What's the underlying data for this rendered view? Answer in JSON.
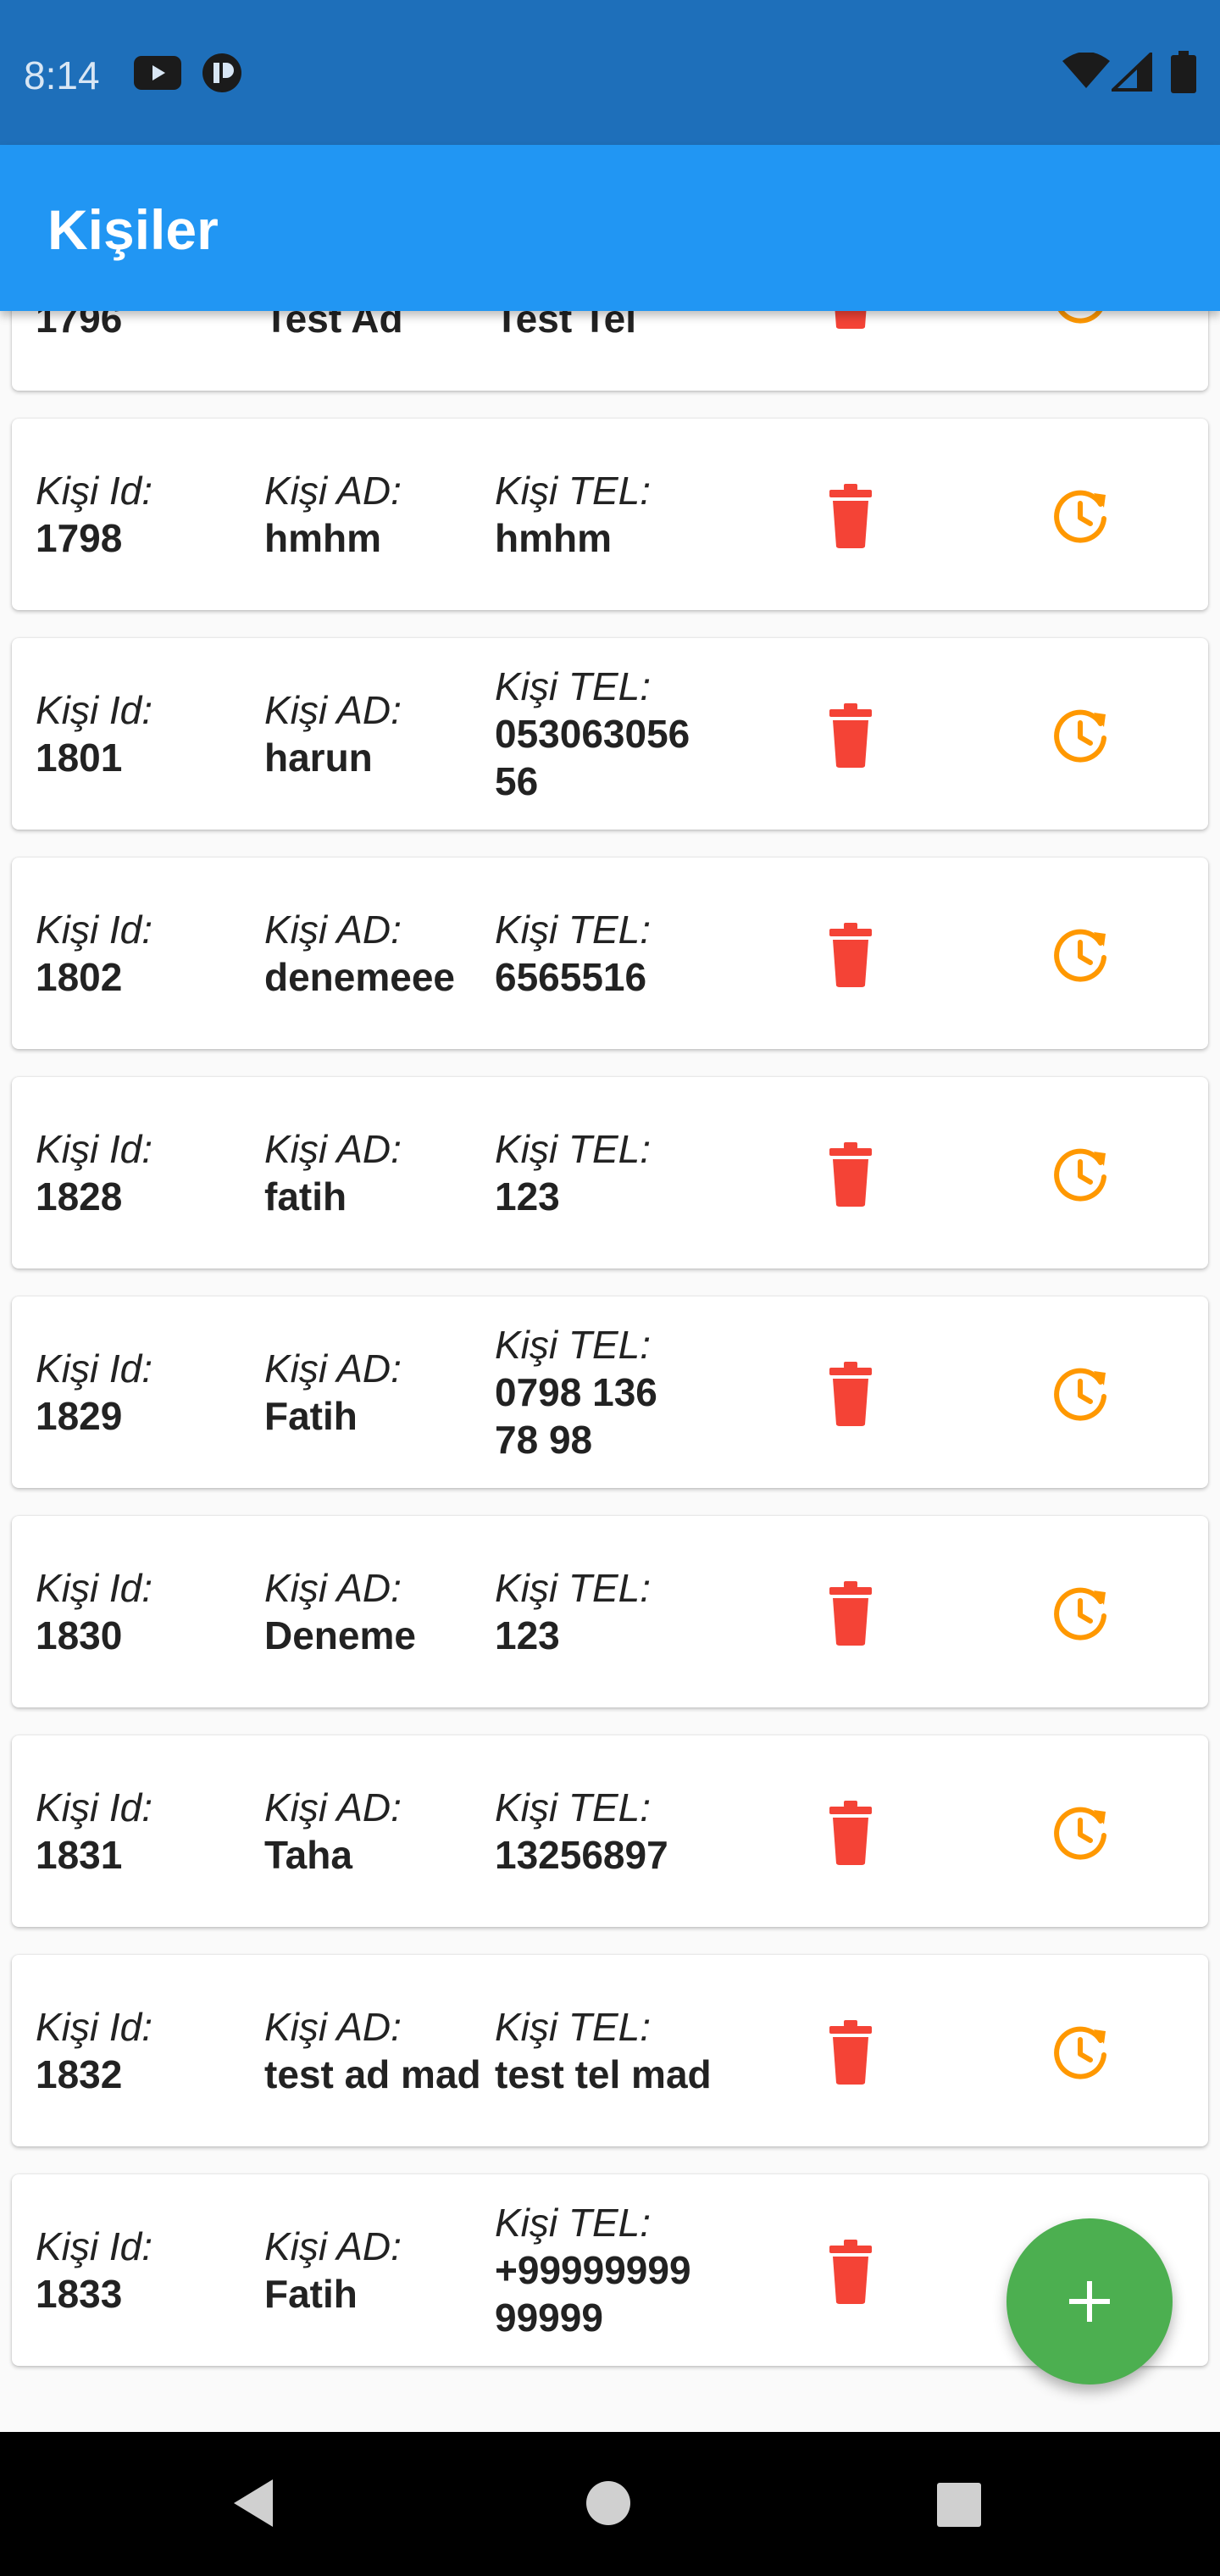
{
  "status_bar": {
    "time": "8:14"
  },
  "app_bar": {
    "title": "Kişiler"
  },
  "labels": {
    "id": "Kişi Id:",
    "ad": "Kişi AD:",
    "tel": "Kişi TEL:"
  },
  "contacts": [
    {
      "id": "1796",
      "ad": "Test  Ad",
      "tel": "Test Tel"
    },
    {
      "id": "1798",
      "ad": "hmhm",
      "tel": "hmhm"
    },
    {
      "id": "1801",
      "ad": "harun",
      "tel": "053063056\n56"
    },
    {
      "id": "1802",
      "ad": "denemeee",
      "tel": "6565516"
    },
    {
      "id": "1828",
      "ad": "fatih",
      "tel": "123"
    },
    {
      "id": "1829",
      "ad": "Fatih",
      "tel": "0798 136\n78 98"
    },
    {
      "id": "1830",
      "ad": "Deneme",
      "tel": "123"
    },
    {
      "id": "1831",
      "ad": "Taha",
      "tel": "13256897"
    },
    {
      "id": "1832",
      "ad": "test ad mad",
      "tel": "test tel mad"
    },
    {
      "id": "1833",
      "ad": "Fatih",
      "tel": "+99999999\n99999"
    }
  ],
  "colors": {
    "status_bar": "#1e6fba",
    "app_bar": "#2196f3",
    "delete_icon": "#f44336",
    "update_icon": "#ff9800",
    "fab": "#4caf50"
  },
  "icons": {
    "delete": "trash-icon",
    "update": "update-clock-icon",
    "fab": "plus-icon"
  }
}
